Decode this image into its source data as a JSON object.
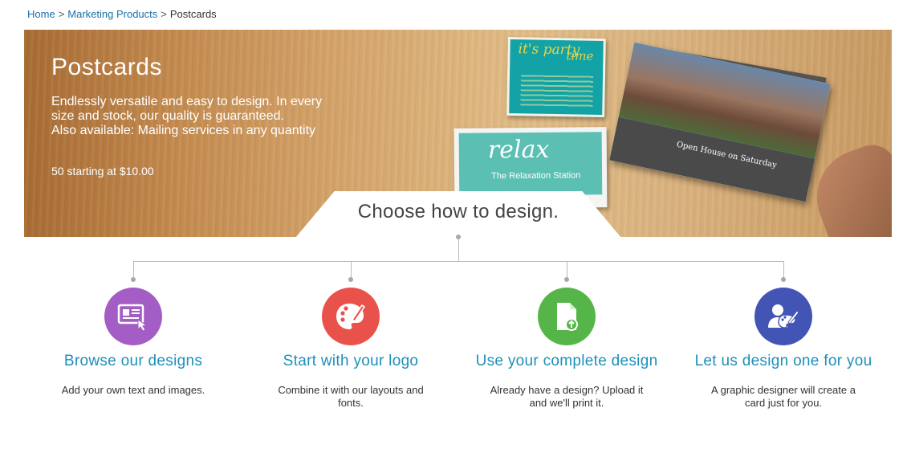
{
  "breadcrumb": {
    "home": "Home",
    "sep1": ">",
    "category": "Marketing Products",
    "sep2": ">",
    "current": "Postcards"
  },
  "hero": {
    "title": "Postcards",
    "description_lines": [
      "Endlessly versatile and easy to design. In every",
      "size and stock, our quality is guaranteed.",
      "Also available: Mailing services in any quantity"
    ],
    "price": "50 starting at $10.00",
    "card_party_text": [
      "it's party",
      "time"
    ],
    "card_relax_text": [
      "relax",
      "The Relaxation Station"
    ],
    "card_house_text": "Open House on Saturday"
  },
  "choose": {
    "heading": "Choose how to design."
  },
  "options": [
    {
      "label": "Browse our designs",
      "description": "Add your own text and images.",
      "icon": "browse-designs-icon",
      "color": "#a35dc4"
    },
    {
      "label": "Start with your logo",
      "description": "Combine it with our layouts and fonts.",
      "icon": "palette-icon",
      "color": "#e9524a"
    },
    {
      "label": "Use your complete design",
      "description": "Already have a design? Upload it and we'll print it.",
      "icon": "upload-document-icon",
      "color": "#56b548"
    },
    {
      "label": "Let us design one for you",
      "description": "A graphic designer will create a card just for you.",
      "icon": "designer-icon",
      "color": "#4255b5"
    }
  ],
  "colors": {
    "link": "#1a6fa8",
    "option_label": "#1d8fba"
  }
}
